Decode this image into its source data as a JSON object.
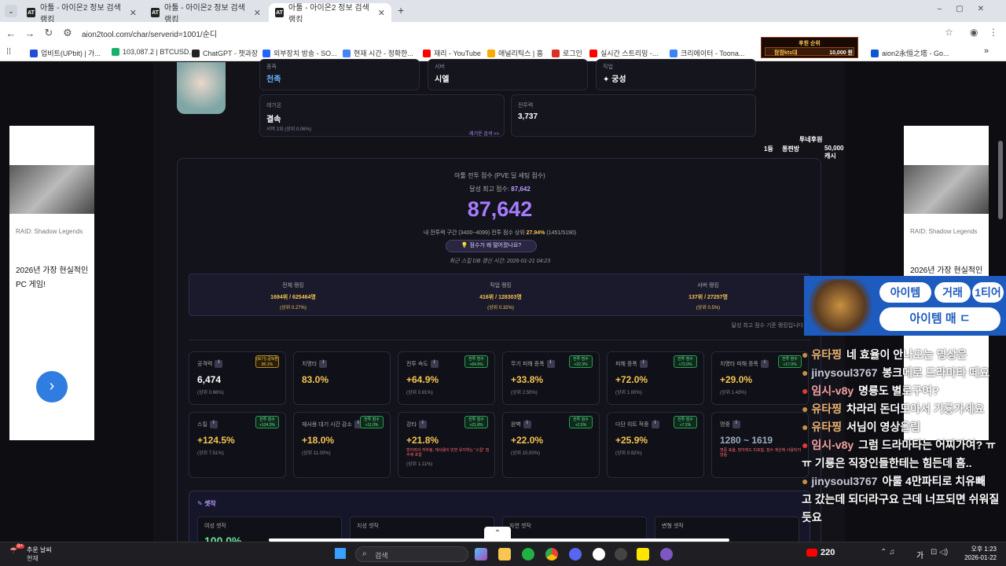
{
  "browser": {
    "tabs": [
      {
        "label": "아툴 - 아이온2 정보 검색 랭킹"
      },
      {
        "label": "아툴 - 아이온2 정보 검색 랭킹"
      },
      {
        "label": "아툴 - 아이온2 정보 검색 랭킹"
      }
    ],
    "new_tab": "+",
    "url": "aion2tool.com/char/serverid=1001/순디",
    "bookmarks": [
      "업비트(UPbit) | 가...",
      "103,087.2 | BTCUSD...",
      "ChatGPT - 챗과장",
      "외부장치 방송 - SO...",
      "현재 시간 - 정확한...",
      "재리 - YouTube",
      "애널리틱스 | 홈",
      "로그인",
      "실시간 스트리밍 -...",
      "크리에이터 - Toona...",
      "aion2永恒之塔 - Go..."
    ],
    "bookmark_colors": [
      "#1e4fd8",
      "#17b06b",
      "#222222",
      "#2266ff",
      "#4285f4",
      "#ff0000",
      "#f9ab00",
      "#d93025",
      "#ff0000",
      "#3b82f6",
      "#0b57d0"
    ]
  },
  "donation": {
    "title": "후원 순위",
    "name": "팜팜kts대",
    "amount": "10,000 원",
    "rank_title": "투네후원",
    "rank_no": "1등",
    "rank_name": "퐁찐방",
    "rank_amount": "50,000캐시"
  },
  "profile": {
    "race_label": "종족",
    "race_value": "천족",
    "server_label": "서버",
    "server_value": "시엘",
    "class_label": "직업",
    "class_value": "궁성",
    "legion_label": "레기온",
    "legion_value": "결속",
    "legion_sub": "서버 1위 (상위 0.06%)",
    "legion_link": "레기온 검색 >>",
    "power_label": "전투력",
    "power_value": "3,737"
  },
  "score": {
    "title": "아툴 전투 점수 (PVE 딜 세팅 점수)",
    "best_label": "달성 최고 점수:",
    "best_value": "87,642",
    "main_value": "87,642",
    "range_text": "내 전투력 구간 (3400~4099) 전투 점수 상위",
    "range_pct": "27.94%",
    "range_count": "(1451/5190)",
    "why_button": "점수가 왜 떨어졌나요?",
    "updated": "최근 스킬 DB 갱신 시간: 2026-01-21 04:23",
    "rankings": [
      {
        "label": "전체 랭킹",
        "value": "1694위 / 625464명",
        "pct": "(상위 0.27%)"
      },
      {
        "label": "직업 랭킹",
        "value": "416위 / 128303명",
        "pct": "(상위 0.32%)"
      },
      {
        "label": "서버 랭킹",
        "value": "137위 / 27257명",
        "pct": "(상위 0.5%)"
      }
    ],
    "rank_note": "달성 최고 점수 기준 랭킹입니다"
  },
  "stats_row1": [
    {
      "name": "공격력",
      "value": "6,474",
      "rank": "(상위 0.66%)",
      "badge": "(IE기) 공%환 80.1%",
      "gold": true,
      "white": true
    },
    {
      "name": "치명타",
      "value": "83.0%",
      "rank": "",
      "badge": "",
      "gold": false
    },
    {
      "name": "전투 속도",
      "value": "+64.9%",
      "rank": "(상위 0.81%)",
      "badge": "전투 점수 +64.9%",
      "gold": false
    },
    {
      "name": "무기 피해 증폭",
      "value": "+33.8%",
      "rank": "(상위 2.50%)",
      "badge": "전투 점수 +22.3%",
      "gold": false
    },
    {
      "name": "피해 증폭",
      "value": "+72.0%",
      "rank": "(상위 1.00%)",
      "badge": "전투 점수 +72.0%",
      "gold": false
    },
    {
      "name": "치명타 피해 증폭",
      "value": "+29.0%",
      "rank": "(상위 1.43%)",
      "badge": "전투 점수 +17.0%",
      "gold": false
    }
  ],
  "stats_row2": [
    {
      "name": "스킬",
      "value": "+124.5%",
      "rank": "(상위 7.51%)",
      "badge": "전투 점수 +124.5%",
      "gold": false
    },
    {
      "name": "재사용 대기 시간 감소",
      "value": "+18.0%",
      "rank": "(상위 11.00%)",
      "badge": "전투 점수 +11.0%",
      "gold": false
    },
    {
      "name": "강타",
      "value": "+21.8%",
      "rank": "(상위 1.11%)",
      "badge": "전투 점수 +21.8%",
      "gold": false,
      "note": "방어력의 저하됨, 재사용이 빈번 유지하는 \"스킬\" 점수에 포함"
    },
    {
      "name": "완벽",
      "value": "+22.0%",
      "rank": "(상위 15.00%)",
      "badge": "전투 점수 +2.5%",
      "gold": false
    },
    {
      "name": "다단 히트 적중",
      "value": "+25.9%",
      "rank": "(상위 0.92%)",
      "badge": "전투 점수 +7.2%",
      "gold": false
    },
    {
      "name": "명중",
      "value": "1280 ~ 1619",
      "rank": "",
      "badge": "",
      "gold": false,
      "grey": true,
      "note": "명중 표율, 방어력드 미포함, 점수 계산에 사용되지 않음"
    }
  ],
  "set_section": {
    "title": "셋작",
    "cols": [
      "여성 셋작",
      "지성 셋작",
      "자연 셋작",
      "변형 셋작"
    ],
    "first_value": "100.0%"
  },
  "ad": {
    "game": "RAID: Shadow Legends",
    "headline": "2026년 가장 현실적인 PC 게임!"
  },
  "overlay": {
    "banner1": "아이템",
    "banner2": "거래",
    "banner3": "1티어",
    "banner4": "아이템 매 ㄷ"
  },
  "chat": [
    {
      "user": "유타찡",
      "msg": "네 효율이 안나오는 영상은",
      "cls": ""
    },
    {
      "user": "jinysoul3767",
      "msg": "봉크메로 드라마타 떼요",
      "cls": "j"
    },
    {
      "user": "임시-v8y",
      "msg": "명룡도 별로구여?",
      "cls": "v"
    },
    {
      "user": "유타찡",
      "msg": "차라리 돈더모아서 기룡가세요",
      "cls": ""
    },
    {
      "user": "유타찡",
      "msg": "서님이 영상올림",
      "cls": ""
    },
    {
      "user": "임시-v8y",
      "msg": "그럼 드라마타는 어찌가여? ㅠ",
      "cls": "v"
    },
    {
      "user": "",
      "msg": "ㅠ 기룡은 직장인들한테는 힘든데 흠..",
      "cls": ""
    },
    {
      "user": "jinysoul3767",
      "msg": "아룰 4만파티로 치유빼",
      "cls": "j"
    },
    {
      "user": "",
      "msg": "고 갔는데 되더라구요 근데 너프되면 쉬워질",
      "cls": ""
    },
    {
      "user": "",
      "msg": "듯요",
      "cls": ""
    }
  ],
  "taskbar": {
    "weather": "추운 날씨",
    "weather_sub": "현재",
    "search": "검색",
    "viewers": "220",
    "time": "오후 1:23",
    "date": "2026-01-22",
    "ime": "가",
    "badge": "9+"
  }
}
